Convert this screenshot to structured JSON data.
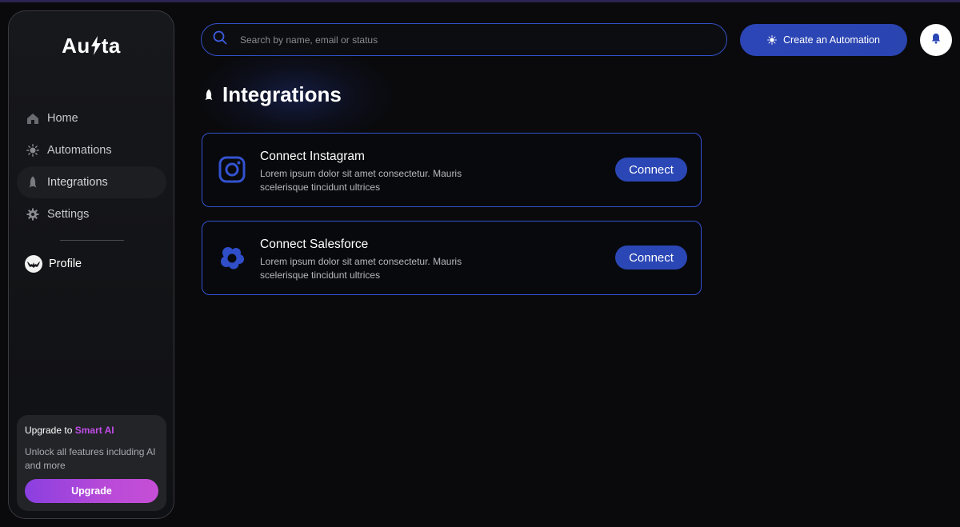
{
  "sidebar": {
    "logo_text_left": "Au",
    "logo_text_right": "ta",
    "nav": [
      {
        "label": "Home",
        "icon": "home-icon"
      },
      {
        "label": "Automations",
        "icon": "sparkle-icon"
      },
      {
        "label": "Integrations",
        "icon": "rocket-icon",
        "active": true
      },
      {
        "label": "Settings",
        "icon": "gear-icon"
      }
    ],
    "profile_label": "Profile",
    "upgrade": {
      "title_prefix": "Upgrade to ",
      "title_highlight": "Smart AI",
      "description": "Unlock all features including AI and more",
      "button_label": "Upgrade"
    }
  },
  "header": {
    "search_placeholder": "Search by name, email or status",
    "create_button_label": "Create an Automation"
  },
  "page": {
    "title": "Integrations"
  },
  "integrations": [
    {
      "title": "Connect Instagram",
      "description": "Lorem ipsum dolor sit amet consectetur. Mauris scelerisque tincidunt ultrices",
      "button_label": "Connect",
      "icon": "instagram-icon"
    },
    {
      "title": "Connect Salesforce",
      "description": "Lorem ipsum dolor sit amet consectetur. Mauris scelerisque tincidunt ultrices",
      "button_label": "Connect",
      "icon": "salesforce-icon"
    }
  ],
  "colors": {
    "accent_blue": "#3352d0",
    "button_blue": "#2b47b6",
    "smart_ai_purple": "#c04de8"
  }
}
